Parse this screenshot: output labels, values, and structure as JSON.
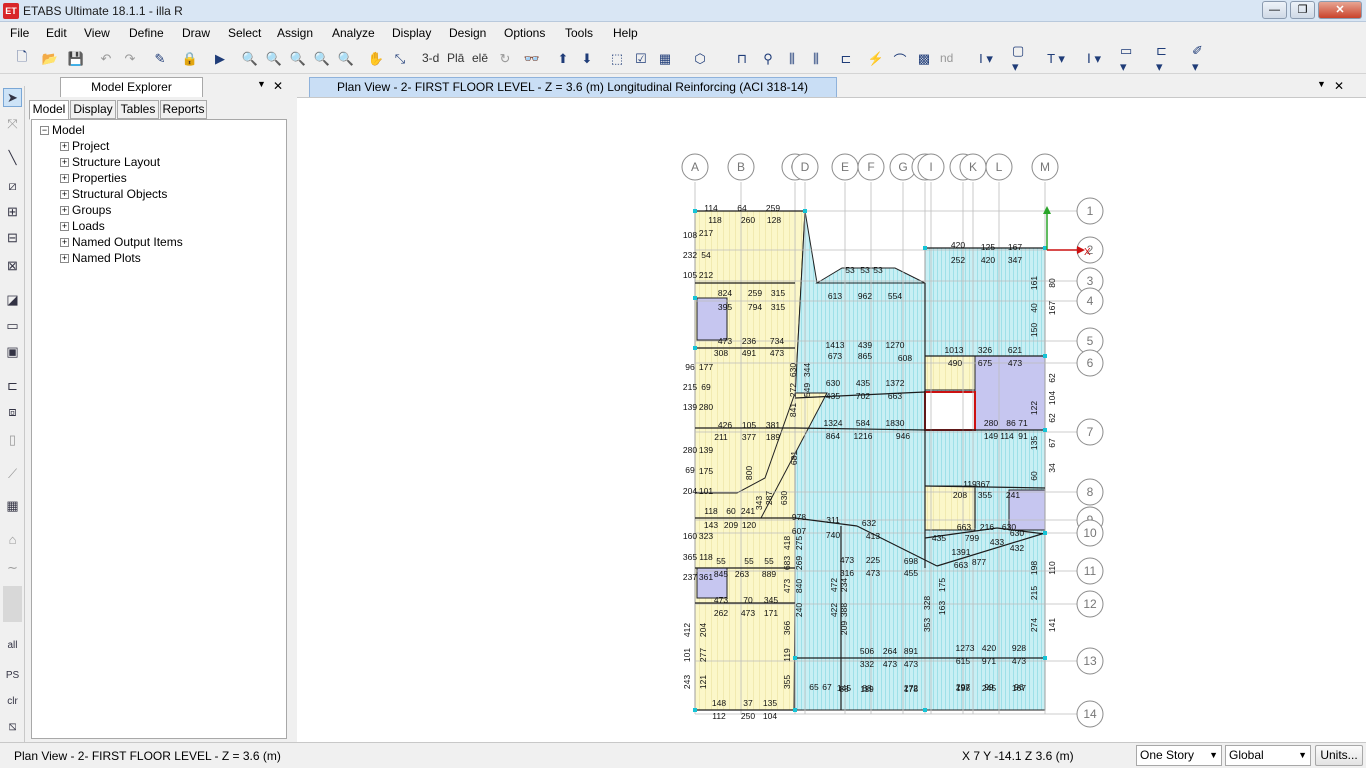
{
  "window": {
    "title": "ETABS Ultimate 18.1.1 - illa R",
    "logo_text": "ET",
    "minimize": "—",
    "restore": "❐",
    "close": "✕"
  },
  "menu": [
    "File",
    "Edit",
    "View",
    "Define",
    "Draw",
    "Select",
    "Assign",
    "Analyze",
    "Display",
    "Design",
    "Options",
    "Tools",
    "Help"
  ],
  "toolbar": {
    "view_3d": "3-d",
    "view_plan": "Plā",
    "view_elev": "elē",
    "view_nd": "nd"
  },
  "left_tools": {
    "all": "all",
    "ps": "PS",
    "clr": "clr"
  },
  "explorer": {
    "title": "Model Explorer",
    "tabs": [
      "Model",
      "Display",
      "Tables",
      "Reports"
    ],
    "root": "Model",
    "items": [
      "Project",
      "Structure Layout",
      "Properties",
      "Structural Objects",
      "Groups",
      "Loads",
      "Named Output Items",
      "Named Plots"
    ]
  },
  "view": {
    "tab_title": "Plan View - 2- FIRST FLOOR LEVEL - Z = 3.6 (m)  Longitudinal Reinforcing  (ACI 318-14)",
    "col_grid": [
      {
        "label": "A"
      },
      {
        "label": "B"
      },
      {
        "label": "C"
      },
      {
        "label": "D"
      },
      {
        "label": "E"
      },
      {
        "label": "F"
      },
      {
        "label": "G"
      },
      {
        "label": "H"
      },
      {
        "label": "I"
      },
      {
        "label": "J"
      },
      {
        "label": "K"
      },
      {
        "label": "L"
      },
      {
        "label": "M"
      }
    ],
    "row_grid": [
      {
        "label": "1"
      },
      {
        "label": "2"
      },
      {
        "label": "3"
      },
      {
        "label": "4"
      },
      {
        "label": "5"
      },
      {
        "label": "6"
      },
      {
        "label": "7"
      },
      {
        "label": "8"
      },
      {
        "label": "9"
      },
      {
        "label": "10"
      },
      {
        "label": "11"
      },
      {
        "label": "12"
      },
      {
        "label": "13"
      },
      {
        "label": "14"
      }
    ],
    "axis_x_label": "X",
    "rebar_labels": [
      {
        "t": "114"
      },
      {
        "t": "64"
      },
      {
        "t": "259"
      },
      {
        "t": "118"
      },
      {
        "t": "260"
      },
      {
        "t": "128"
      },
      {
        "t": "824"
      },
      {
        "t": "259"
      },
      {
        "t": "315"
      },
      {
        "t": "395"
      },
      {
        "t": "794"
      },
      {
        "t": "315"
      },
      {
        "t": "473"
      },
      {
        "t": "236"
      },
      {
        "t": "734"
      },
      {
        "t": "308"
      },
      {
        "t": "491"
      },
      {
        "t": "473"
      },
      {
        "t": "426"
      },
      {
        "t": "105"
      },
      {
        "t": "381"
      },
      {
        "t": "211"
      },
      {
        "t": "377"
      },
      {
        "t": "189"
      },
      {
        "t": "118"
      },
      {
        "t": "60"
      },
      {
        "t": "241"
      },
      {
        "t": "143"
      },
      {
        "t": "209"
      },
      {
        "t": "120"
      },
      {
        "t": "55"
      },
      {
        "t": "55"
      },
      {
        "t": "55"
      },
      {
        "t": "845"
      },
      {
        "t": "263"
      },
      {
        "t": "889"
      },
      {
        "t": "473"
      },
      {
        "t": "70"
      },
      {
        "t": "345"
      },
      {
        "t": "262"
      },
      {
        "t": "473"
      },
      {
        "t": "171"
      },
      {
        "t": "148"
      },
      {
        "t": "37"
      },
      {
        "t": "135"
      },
      {
        "t": "112"
      },
      {
        "t": "250"
      },
      {
        "t": "104"
      },
      {
        "t": "53"
      },
      {
        "t": "53"
      },
      {
        "t": "53"
      },
      {
        "t": "613"
      },
      {
        "t": "962"
      },
      {
        "t": "554"
      },
      {
        "t": "1413"
      },
      {
        "t": "439"
      },
      {
        "t": "1270"
      },
      {
        "t": "673"
      },
      {
        "t": "865"
      },
      {
        "t": "608"
      },
      {
        "t": "630"
      },
      {
        "t": "435"
      },
      {
        "t": "1372"
      },
      {
        "t": "435"
      },
      {
        "t": "702"
      },
      {
        "t": "663"
      },
      {
        "t": "1324"
      },
      {
        "t": "584"
      },
      {
        "t": "1830"
      },
      {
        "t": "864"
      },
      {
        "t": "1216"
      },
      {
        "t": "946"
      },
      {
        "t": "978"
      },
      {
        "t": "311"
      },
      {
        "t": "632"
      },
      {
        "t": "607"
      },
      {
        "t": "740"
      },
      {
        "t": "413"
      },
      {
        "t": "473"
      },
      {
        "t": "225"
      },
      {
        "t": "698"
      },
      {
        "t": "316"
      },
      {
        "t": "473"
      },
      {
        "t": "455"
      },
      {
        "t": "506"
      },
      {
        "t": "264"
      },
      {
        "t": "891"
      },
      {
        "t": "332"
      },
      {
        "t": "473"
      },
      {
        "t": "473"
      },
      {
        "t": "145"
      },
      {
        "t": "88"
      },
      {
        "t": "272"
      },
      {
        "t": "88"
      },
      {
        "t": "119"
      },
      {
        "t": "178"
      },
      {
        "t": "65"
      },
      {
        "t": "67"
      },
      {
        "t": "420"
      },
      {
        "t": "125"
      },
      {
        "t": "167"
      },
      {
        "t": "252"
      },
      {
        "t": "420"
      },
      {
        "t": "347"
      },
      {
        "t": "1013"
      },
      {
        "t": "326"
      },
      {
        "t": "621"
      },
      {
        "t": "490"
      },
      {
        "t": "675"
      },
      {
        "t": "473"
      },
      {
        "t": "280"
      },
      {
        "t": "86"
      },
      {
        "t": "71"
      },
      {
        "t": "149"
      },
      {
        "t": "114"
      },
      {
        "t": "91"
      },
      {
        "t": "119"
      },
      {
        "t": "367"
      },
      {
        "t": "208"
      },
      {
        "t": "355"
      },
      {
        "t": "241"
      },
      {
        "t": "663"
      },
      {
        "t": "216"
      },
      {
        "t": "630"
      },
      {
        "t": "435"
      },
      {
        "t": "799"
      },
      {
        "t": "433"
      },
      {
        "t": "630"
      },
      {
        "t": "1391"
      },
      {
        "t": "432"
      },
      {
        "t": "663"
      },
      {
        "t": "877"
      },
      {
        "t": "1273"
      },
      {
        "t": "420"
      },
      {
        "t": "928"
      },
      {
        "t": "615"
      },
      {
        "t": "971"
      },
      {
        "t": "473"
      },
      {
        "t": "297"
      },
      {
        "t": "99"
      },
      {
        "t": "96"
      },
      {
        "t": "198"
      },
      {
        "t": "245"
      },
      {
        "t": "167"
      },
      {
        "t": "108"
      },
      {
        "t": "232"
      },
      {
        "t": "105"
      },
      {
        "t": "217"
      },
      {
        "t": "54"
      },
      {
        "t": "212"
      },
      {
        "t": "96"
      },
      {
        "t": "215"
      },
      {
        "t": "139"
      },
      {
        "t": "177"
      },
      {
        "t": "69"
      },
      {
        "t": "280"
      },
      {
        "t": "280"
      },
      {
        "t": "69"
      },
      {
        "t": "204"
      },
      {
        "t": "139"
      },
      {
        "t": "175"
      },
      {
        "t": "101"
      },
      {
        "t": "160"
      },
      {
        "t": "365"
      },
      {
        "t": "237"
      },
      {
        "t": "323"
      },
      {
        "t": "118"
      },
      {
        "t": "361"
      },
      {
        "t": "412"
      },
      {
        "t": "101"
      },
      {
        "t": "243"
      },
      {
        "t": "204"
      },
      {
        "t": "277"
      },
      {
        "t": "121"
      },
      {
        "t": "630"
      },
      {
        "t": "272"
      },
      {
        "t": "841"
      },
      {
        "t": "549"
      },
      {
        "t": "344"
      },
      {
        "t": "418"
      },
      {
        "t": "275"
      },
      {
        "t": "269"
      },
      {
        "t": "683"
      },
      {
        "t": "840"
      },
      {
        "t": "473"
      },
      {
        "t": "366"
      },
      {
        "t": "119"
      },
      {
        "t": "355"
      },
      {
        "t": "240"
      },
      {
        "t": "422"
      },
      {
        "t": "472"
      },
      {
        "t": "234"
      },
      {
        "t": "388"
      },
      {
        "t": "209"
      },
      {
        "t": "328"
      },
      {
        "t": "353"
      },
      {
        "t": "175"
      },
      {
        "t": "163"
      },
      {
        "t": "161"
      },
      {
        "t": "80"
      },
      {
        "t": "40"
      },
      {
        "t": "167"
      },
      {
        "t": "150"
      },
      {
        "t": "62"
      },
      {
        "t": "104"
      },
      {
        "t": "62"
      },
      {
        "t": "122"
      },
      {
        "t": "135"
      },
      {
        "t": "67"
      },
      {
        "t": "34"
      },
      {
        "t": "60"
      },
      {
        "t": "198"
      },
      {
        "t": "110"
      },
      {
        "t": "215"
      },
      {
        "t": "274"
      },
      {
        "t": "141"
      },
      {
        "t": "800"
      },
      {
        "t": "287"
      },
      {
        "t": "630"
      },
      {
        "t": "343"
      },
      {
        "t": "681"
      }
    ]
  },
  "status": {
    "left": "Plan View - 2- FIRST FLOOR LEVEL - Z = 3.6 (m)",
    "coords": "X 7  Y -14.1  Z 3.6 (m)",
    "story": "One Story",
    "csys": "Global",
    "units": "Units..."
  }
}
